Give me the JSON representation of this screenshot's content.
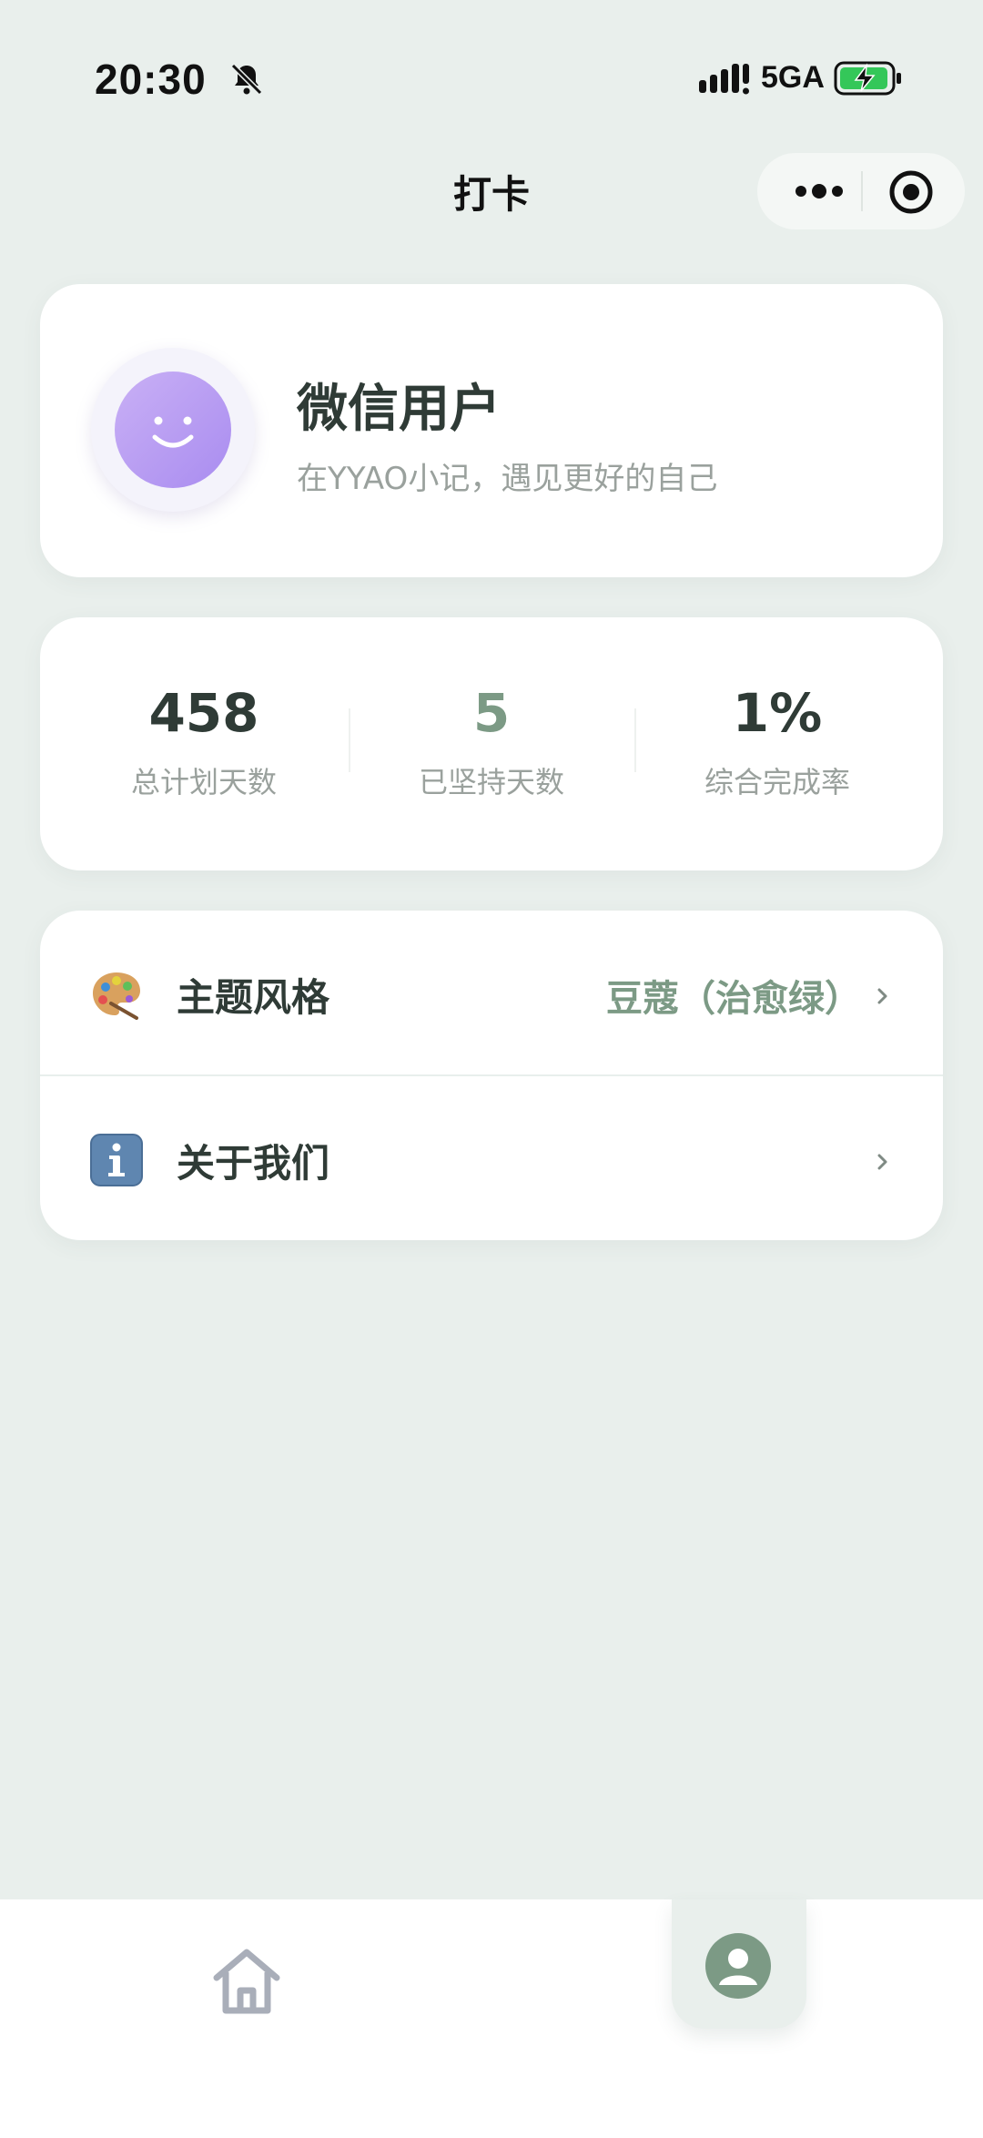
{
  "status_bar": {
    "time": "20:30",
    "network": "5GA",
    "icons": [
      "bell-off-icon",
      "signal-icon",
      "battery-charging-icon"
    ]
  },
  "nav": {
    "title": "打卡",
    "icons": [
      "more-icon",
      "target-icon"
    ]
  },
  "profile": {
    "name": "微信用户",
    "slogan": "在YYAO小记，遇见更好的自己",
    "avatar_icon": "smile-icon"
  },
  "stats": [
    {
      "value": "458",
      "label": "总计划天数"
    },
    {
      "value": "5",
      "label": "已坚持天数"
    },
    {
      "value": "1%",
      "label": "综合完成率"
    }
  ],
  "menu": {
    "theme": {
      "icon": "palette-icon",
      "label": "主题风格",
      "value": "豆蔻（治愈绿）"
    },
    "about": {
      "icon": "info-icon",
      "label": "关于我们"
    }
  },
  "tabbar": {
    "icons": [
      "home-icon",
      "user-icon"
    ],
    "active": "user"
  },
  "colors": {
    "background": "#e9efec",
    "accent": "#7c9a85",
    "text": "#2f3b36",
    "muted": "#9aa19d",
    "avatar": "#a98cf0"
  }
}
